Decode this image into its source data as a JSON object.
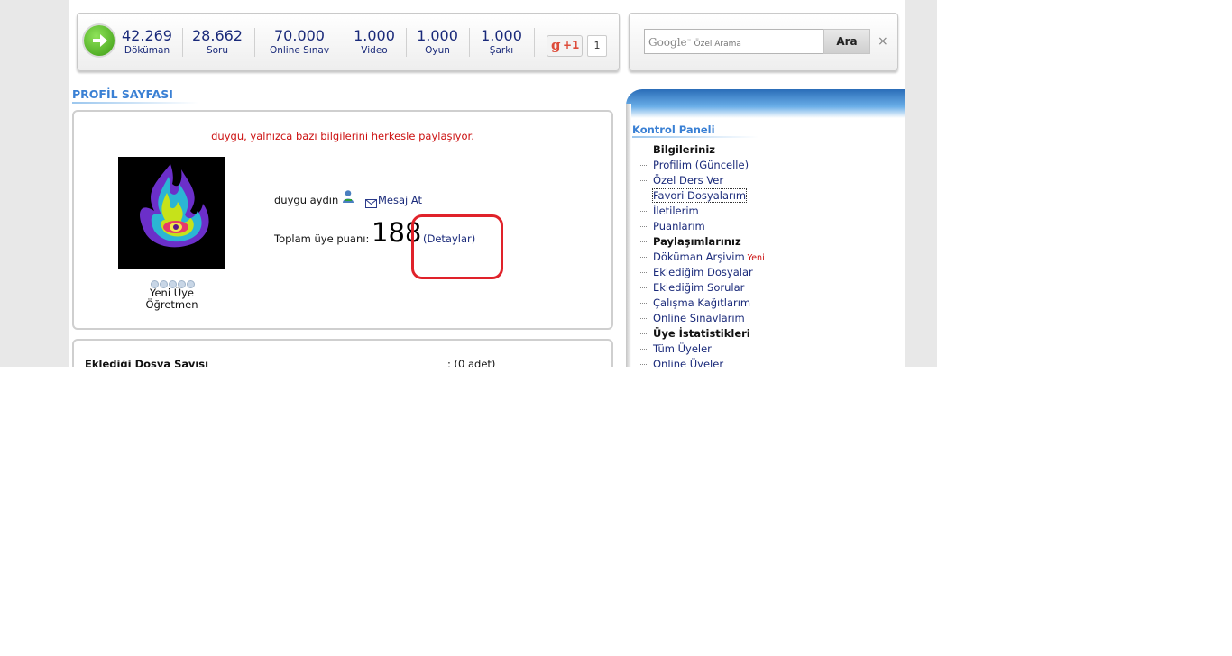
{
  "stats": [
    {
      "value": "42.269",
      "label": "Döküman"
    },
    {
      "value": "28.662",
      "label": "Soru"
    },
    {
      "value": "70.000",
      "label": "Online Sınav"
    },
    {
      "value": "1.000",
      "label": "Video"
    },
    {
      "value": "1.000",
      "label": "Oyun"
    },
    {
      "value": "1.000",
      "label": "Şarkı"
    }
  ],
  "gplus": {
    "label": "+1",
    "count": "1"
  },
  "search": {
    "placeholder": "Özel Arama",
    "brand": "Google",
    "button": "Ara",
    "clear": "×"
  },
  "profile": {
    "section_title": "PROFİL SAYFASI",
    "share_notice": "duygu, yalnızca bazı bilgilerini herkesle paylaşıyor.",
    "username": "duygu aydın",
    "message_link": "Mesaj At",
    "points_label": "Toplam üye puanı:",
    "points_value": "188",
    "details_link": "(Detaylar)",
    "member_level": "Yeni Üye",
    "member_type": "Öğretmen",
    "rating_stars": 0
  },
  "stats2": {
    "label": "Eklediği Dosya Sayısı",
    "value": ": (0 adet)"
  },
  "control_panel": {
    "title": "Kontrol Paneli",
    "items": [
      {
        "label": "Bilgileriniz",
        "heading": true
      },
      {
        "label": "Profilim (Güncelle)"
      },
      {
        "label": "Özel Ders Ver"
      },
      {
        "label": "Favori Dosyalarım"
      },
      {
        "label": "İletilerim"
      },
      {
        "label": "Puanlarım"
      },
      {
        "label": "Paylaşımlarınız",
        "heading": true
      },
      {
        "label": "Döküman Arşivim",
        "badge": "Yeni"
      },
      {
        "label": "Eklediğim Dosyalar"
      },
      {
        "label": "Eklediğim Sorular"
      },
      {
        "label": "Çalışma Kağıtlarım"
      },
      {
        "label": "Online Sınavlarım"
      },
      {
        "label": "Üye İstatistikleri",
        "heading": true
      },
      {
        "label": "Tüm Üyeler"
      },
      {
        "label": "Online Üyeler"
      }
    ]
  },
  "colors": {
    "link": "#1a2a7a",
    "accent": "#3a80d4",
    "notice": "#cc1111",
    "annotation": "#e0222a"
  }
}
